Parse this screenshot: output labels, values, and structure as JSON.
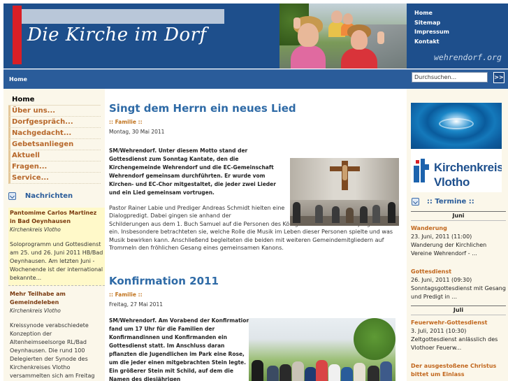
{
  "header": {
    "title": "Die Kirche im Dorf",
    "site_url": "wehrendorf.org",
    "nav": [
      "Home",
      "Sitemap",
      "Impressum",
      "Kontakt"
    ]
  },
  "navbar": {
    "home": "Home",
    "search_value": "Durchsuchen...",
    "search_button": ">>"
  },
  "left_menu": [
    "Home",
    "Über uns...",
    "Dorfgespräch...",
    "Nachgedacht...",
    "Gebetsanliegen",
    "Aktuell",
    "Fragen...",
    "Service..."
  ],
  "news": {
    "heading": "Nachrichten",
    "items": [
      {
        "title": "Pantomime Carlos Martinez in Bad Oeynhausen",
        "source": "Kirchenkreis Vlotho",
        "text": "Soloprogramm und Gottesdienst am 25. und 26. Juni 2011 HB/Bad Oeynhausen. Am letzten Juni - Wochenende ist der international bekannte..."
      },
      {
        "title": "Mehr Teilhabe am Gemeindeleben",
        "source": "Kirchenkreis Vlotho",
        "text": "Kreissynode verabschiedete Konzeption der Altenheimseelsorge RL/Bad Oeynhausen. Die rund 100 Delegierten der Synode des Kirchenkreises Vlotho versammelten sich am Freitag"
      }
    ]
  },
  "articles": [
    {
      "title": "Singt dem Herrn ein neues Lied",
      "category": ":: Familie ::",
      "date": "Montag, 30 Mai 2011",
      "lead": "SM/Wehrendorf. Unter diesem Motto stand der Gottesdienst zum Sonntag Kantate, den die Kirchengemeinde Wehrendorf und die EC-Gemeinschaft Wehrendorf gemeinsam durchführten. Er wurde vom Kirchen- und EC-Chor mitgestaltet, die jeder zwei Lieder und ein Lied gemeinsam vortrugen.",
      "body_intro": "Pastor Rainer Labie und Prediger Andreas Schmidt hielten eine Dialogpredigt. Dabei gingen sie anhand der",
      "body": "Schilderungen aus dem 1. Buch Samuel auf die Personen des Königs Saul und des Hirtenjungen David ein. Insbesondere betrachteten sie, welche Rolle die Musik im Leben dieser Personen spielte und was Musik bewirken kann. Anschließend begleiteten die beiden mit weiteren Gemeindemitgliedern auf Trommeln den fröhlichen Gesang eines gemeinsamen Kanons."
    },
    {
      "title": "Konfirmation 2011",
      "category": ":: Familie ::",
      "date": "Freitag, 27 Mai 2011",
      "lead": "SM/Wehrendorf. Am Vorabend der Konfirmation fand um 17 Uhr für die Familien der Konfirmandinnen und Konfirmanden ein Gottesdienst statt. Im Anschluss daran pflanzten die Jugendlichen im Park eine Rose, um die jeder einen mitgebrachten Stein legte. Ein größerer Stein mit Schild, auf dem die Namen des diesjährigen"
    }
  ],
  "right": {
    "logo_text": [
      "Kirchenkreis",
      "Vlotho"
    ],
    "termine_heading": ":: Termine ::",
    "months": [
      {
        "name": "Juni",
        "events": [
          {
            "title": "Wanderung",
            "date": "23. Juni, 2011 (11:00)",
            "desc": "Wanderung der Kirchlichen Vereine Wehrendorf - ..."
          },
          {
            "title": "Gottesdienst",
            "date": "26. Juni, 2011 (09:30)",
            "desc": "Sonntagsgottesdienst mit Gesang und Predigt in ..."
          }
        ]
      },
      {
        "name": "Juli",
        "events": [
          {
            "title": "Feuerwehr-Gottesdienst",
            "date": "3. Juli, 2011 (10:30)",
            "desc": "Zeltgottesdienst anlässlich des Vlothoer Feuerw..."
          },
          {
            "title": "Der ausgestoßene Christus bittet um Einlass",
            "date": "",
            "desc": ""
          }
        ]
      }
    ]
  },
  "colors": {
    "header_blue": "#1e4f8c",
    "nav_blue": "#2a5c9a",
    "accent_red": "#d91f26",
    "link_orange": "#c1661c",
    "title_blue": "#2e6aa6",
    "sidebar_bg": "#fbf7ea"
  }
}
